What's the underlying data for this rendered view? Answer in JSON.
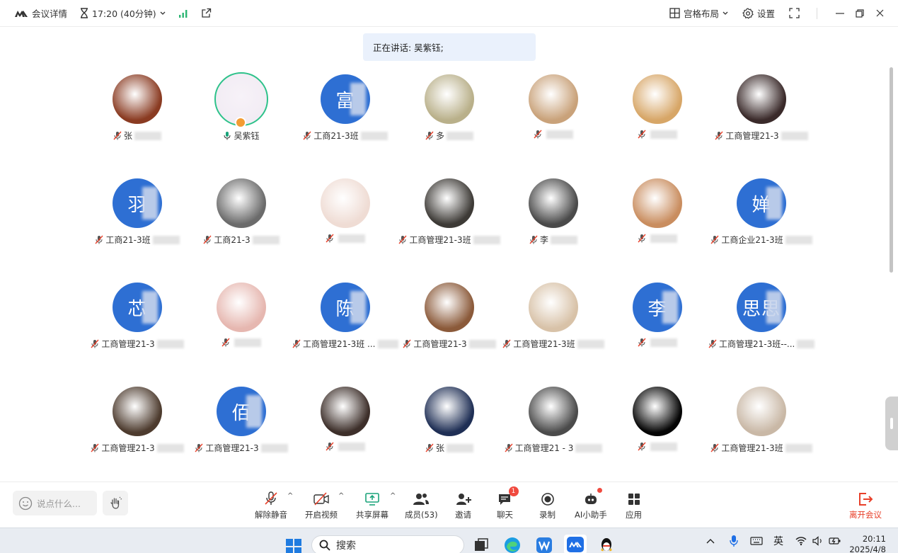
{
  "topbar": {
    "meeting_details": "会议详情",
    "time": "17:20 (40分钟)",
    "layout": "宫格布局",
    "settings": "设置"
  },
  "speaking_banner": "正在讲话: 吴紫钰;",
  "participants": [
    {
      "name": "张",
      "avatar": "photo",
      "mic": "off",
      "color": "#8a3b22"
    },
    {
      "name": "吴紫钰",
      "avatar": "active",
      "mic": "on",
      "color": "#f2ecf4"
    },
    {
      "name": "工商21-3班",
      "avatar": "text",
      "avatar_text": "富",
      "mic": "off"
    },
    {
      "name": "多",
      "avatar": "photo",
      "mic": "off",
      "color": "#b9b08a"
    },
    {
      "name": "",
      "avatar": "photo",
      "mic": "off",
      "color": "#c9a27a"
    },
    {
      "name": "",
      "avatar": "photo",
      "mic": "off",
      "color": "#d7a667"
    },
    {
      "name": "工商管理21-3",
      "avatar": "photo",
      "mic": "off",
      "color": "#3a2a2a"
    },
    {
      "name": "工商21-3班",
      "avatar": "text",
      "avatar_text": "羽",
      "mic": "off"
    },
    {
      "name": "工商21-3",
      "avatar": "photo",
      "mic": "off",
      "color": "#6b6b6b"
    },
    {
      "name": "",
      "avatar": "photo",
      "mic": "off",
      "color": "#efdcd4"
    },
    {
      "name": "工商管理21-3班",
      "avatar": "photo",
      "mic": "off",
      "color": "#3d3a36"
    },
    {
      "name": "李",
      "avatar": "photo",
      "mic": "off",
      "color": "#4a4a4a"
    },
    {
      "name": "",
      "avatar": "photo",
      "mic": "off",
      "color": "#c98d5f"
    },
    {
      "name": "工商企业21-3班",
      "avatar": "text",
      "avatar_text": "婵",
      "mic": "off"
    },
    {
      "name": "工商管理21-3",
      "avatar": "text",
      "avatar_text": "芯",
      "mic": "off"
    },
    {
      "name": "",
      "avatar": "photo",
      "mic": "off",
      "color": "#e6b7b0"
    },
    {
      "name": "工商管理21-3班 ...",
      "avatar": "text",
      "avatar_text": "陈",
      "mic": "off"
    },
    {
      "name": "工商管理21-3",
      "avatar": "photo",
      "mic": "off",
      "color": "#8b5a3a"
    },
    {
      "name": "工商管理21-3班",
      "avatar": "photo",
      "mic": "off",
      "color": "#d8c2a8"
    },
    {
      "name": "",
      "avatar": "text",
      "avatar_text": "李",
      "mic": "off"
    },
    {
      "name": "工商管理21-3班--...",
      "avatar": "text",
      "avatar_text": "思思",
      "mic": "off"
    },
    {
      "name": "工商管理21-3",
      "avatar": "photo",
      "mic": "off",
      "color": "#4d3b2e"
    },
    {
      "name": "工商管理21-3",
      "avatar": "text",
      "avatar_text": "佰",
      "mic": "off"
    },
    {
      "name": "",
      "avatar": "photo",
      "mic": "off",
      "color": "#3d2f2a"
    },
    {
      "name": "张",
      "avatar": "photo",
      "mic": "off",
      "color": "#1f2f55"
    },
    {
      "name": "工商管理21 - 3",
      "avatar": "photo",
      "mic": "off",
      "color": "#4b4b4b"
    },
    {
      "name": "",
      "avatar": "photo",
      "mic": "off",
      "color": "#050505"
    },
    {
      "name": "工商管理21-3班",
      "avatar": "photo",
      "mic": "off",
      "color": "#c9b8a6"
    }
  ],
  "toolbar": {
    "chat_placeholder": "说点什么...",
    "unmute": "解除静音",
    "start_video": "开启视频",
    "share_screen": "共享屏幕",
    "members": "成员(53)",
    "invite": "邀请",
    "chat": "聊天",
    "chat_badge": "1",
    "record": "录制",
    "ai_assistant": "AI小助手",
    "apps": "应用",
    "leave": "离开会议"
  },
  "taskbar": {
    "search": "搜索",
    "ime": "英",
    "time": "20:11",
    "date": "2025/4/8"
  },
  "colors": {
    "accent_blue": "#2e6fd3",
    "active_green": "#2ec28a",
    "leave_red": "#e8402a",
    "badge_red": "#f04a3f"
  }
}
